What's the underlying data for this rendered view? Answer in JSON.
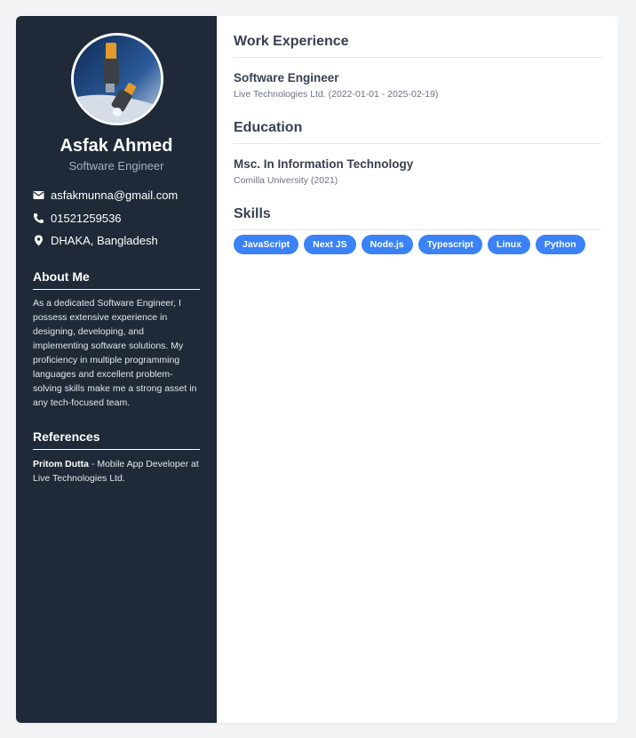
{
  "profile": {
    "name": "Asfak Ahmed",
    "role": "Software Engineer",
    "photo_icon": "profile-photo"
  },
  "contact": {
    "email": "asfakmunna@gmail.com",
    "phone": "01521259536",
    "location": "DHAKA, Bangladesh"
  },
  "about": {
    "title": "About Me",
    "text": "As a dedicated Software Engineer, I possess extensive experience in designing, developing, and implementing software solutions. My proficiency in multiple programming languages and excellent problem-solving skills make me a strong asset in any tech-focused team."
  },
  "references": {
    "title": "References",
    "items": [
      {
        "name": "Pritom Dutta",
        "detail": " - Mobile App Developer at Live Technologies Ltd."
      }
    ]
  },
  "work": {
    "title": "Work Experience",
    "items": [
      {
        "position": "Software Engineer",
        "meta": "Live Technologies Ltd. (2022-01-01 - 2025-02-19)"
      }
    ]
  },
  "education": {
    "title": "Education",
    "items": [
      {
        "degree": "Msc. In Information Technology",
        "meta": "Comilla University (2021)"
      }
    ]
  },
  "skills": {
    "title": "Skills",
    "items": [
      "JavaScript",
      "Next JS",
      "Node.js",
      "Typescript",
      "Linux",
      "Python"
    ]
  },
  "colors": {
    "sidebar_bg": "#1f2937",
    "accent": "#3b82f6",
    "page_bg": "#f2f3f5"
  }
}
